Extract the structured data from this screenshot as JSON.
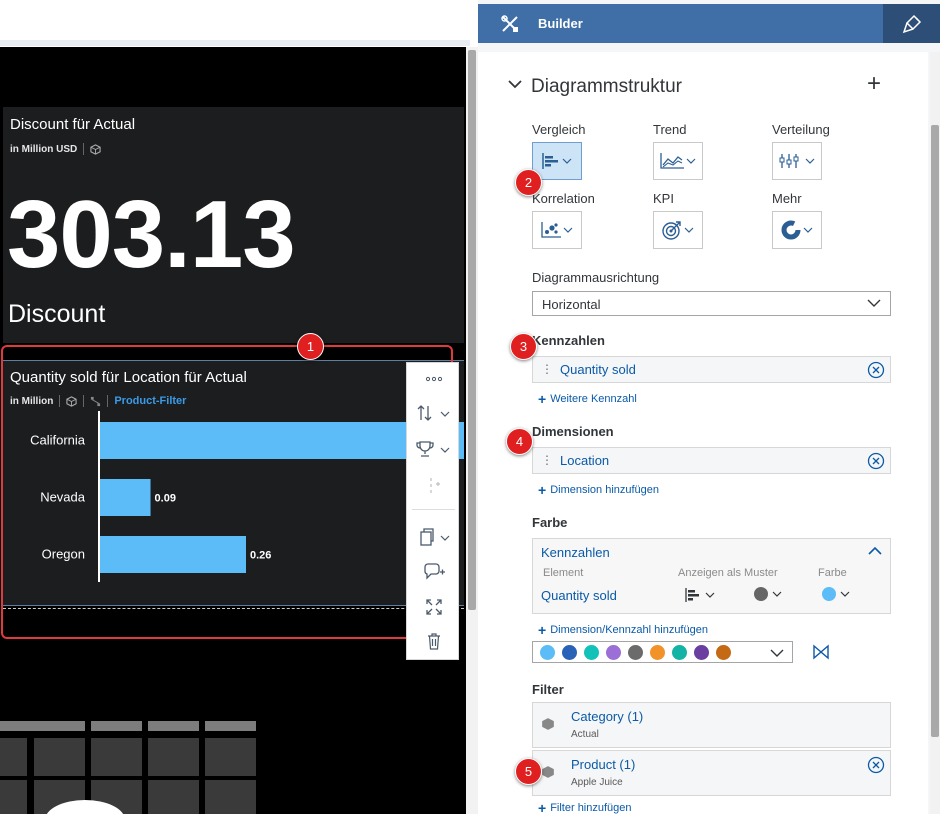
{
  "kpi_tile": {
    "title": "Discount für Actual",
    "subtitle": "in Million USD",
    "value": "303.13",
    "label": "Discount"
  },
  "bar_tile": {
    "title": "Quantity sold für Location für Actual",
    "subtitle": "in Million",
    "filter_link": "Product-Filter"
  },
  "chart_data": {
    "type": "bar",
    "orientation": "horizontal",
    "categories": [
      "California",
      "Nevada",
      "Oregon"
    ],
    "values": [
      0.7,
      0.09,
      0.26
    ],
    "data_labels": [
      "",
      "0.09",
      "0.26"
    ],
    "color": "#5cbcf7",
    "xlim": [
      0,
      0.65
    ]
  },
  "toolbar": {
    "icons": [
      "more-icon",
      "sort-icon",
      "rank-icon",
      "add-dimension-icon",
      "copy-icon",
      "comment-icon",
      "fullscreen-icon",
      "delete-icon"
    ]
  },
  "builder": {
    "header": "Builder",
    "section_title": "Diagrammstruktur",
    "categories": {
      "comparison": "Vergleich",
      "trend": "Trend",
      "distribution": "Verteilung",
      "correlation": "Korrelation",
      "kpi": "KPI",
      "more": "Mehr"
    },
    "orientation_label": "Diagrammausrichtung",
    "orientation_value": "Horizontal",
    "measures_label": "Kennzahlen",
    "measure_item": "Quantity sold",
    "add_measure": "Weitere Kennzahl",
    "dimensions_label": "Dimensionen",
    "dimension_item": "Location",
    "add_dimension": "Dimension hinzufügen",
    "color_label": "Farbe",
    "color_group": "Kennzahlen",
    "color_col_element": "Element",
    "color_col_pattern": "Anzeigen als Muster",
    "color_col_color": "Farbe",
    "color_item": "Quantity sold",
    "add_color": "Dimension/Kennzahl hinzufügen",
    "palette": [
      "#5cbcf7",
      "#2a62b8",
      "#12c2b8",
      "#9b6fd6",
      "#6b6b6b",
      "#f2932a",
      "#13b3a6",
      "#6a3fa0",
      "#c46a15"
    ],
    "filter_label": "Filter",
    "filters": [
      {
        "name": "Category (1)",
        "value": "Actual"
      },
      {
        "name": "Product (1)",
        "value": "Apple Juice"
      }
    ],
    "add_filter": "Filter hinzufügen"
  },
  "callouts": [
    "1",
    "2",
    "3",
    "4",
    "5"
  ]
}
